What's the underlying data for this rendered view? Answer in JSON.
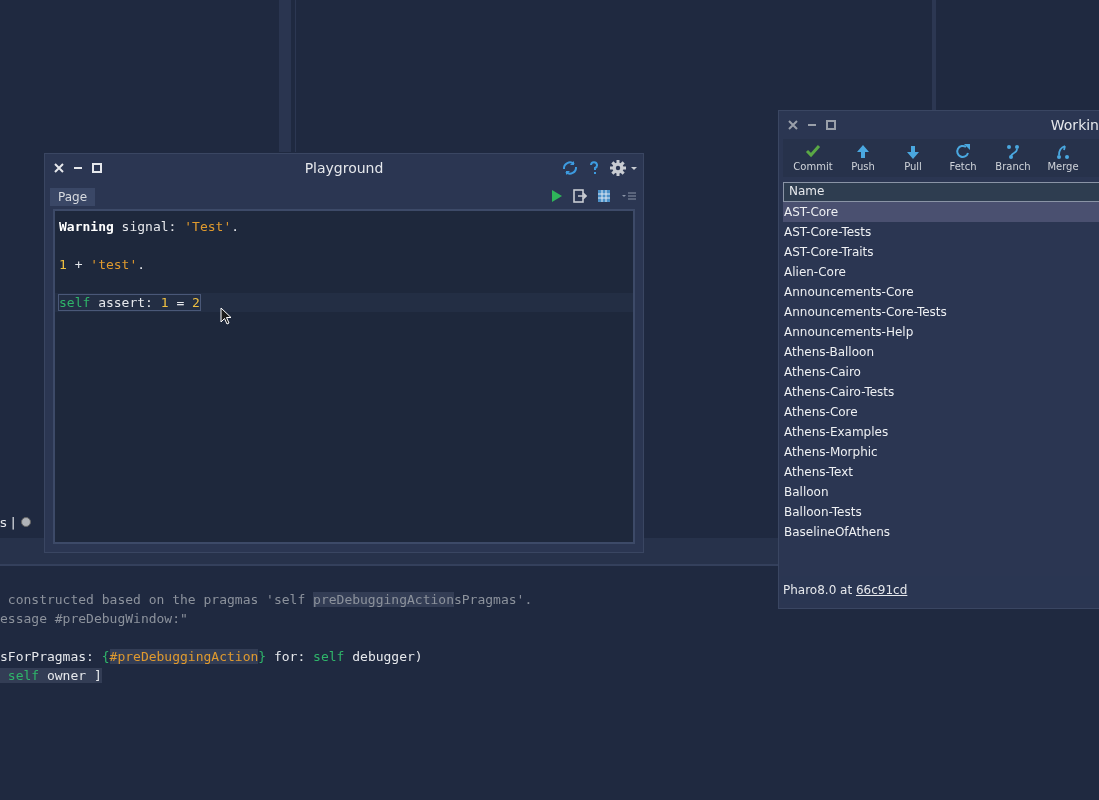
{
  "background_editor": {
    "toolbar_text": "s |",
    "code_lines": [
      {
        "kind": "code",
        "tokens": [
          {
            "text": " constructed based on the pragmas 'self ",
            "kind": "comment"
          },
          {
            "text": "preDebuggingAction",
            "kind": "comment",
            "highlighted": true
          },
          {
            "text": "sPragmas'.",
            "kind": "comment"
          }
        ]
      },
      {
        "kind": "code",
        "tokens": [
          {
            "text": "essage #preDebugWindow:\"",
            "kind": "comment"
          }
        ]
      },
      {
        "kind": "blank"
      },
      {
        "kind": "code",
        "tokens": [
          {
            "text": "sForPragmas: ",
            "kind": "plain"
          },
          {
            "text": "{",
            "kind": "keyword"
          },
          {
            "text": "#preDebuggingAction",
            "kind": "symbol",
            "highlighted": true
          },
          {
            "text": "}",
            "kind": "keyword"
          },
          {
            "text": " for: ",
            "kind": "plain"
          },
          {
            "text": "self",
            "kind": "keyword"
          },
          {
            "text": " debugger)",
            "kind": "plain"
          }
        ]
      },
      {
        "kind": "code",
        "tokens": [
          {
            "text": " self",
            "kind": "keyword",
            "highlighted": true
          },
          {
            "text": " owner ]",
            "kind": "plain",
            "highlighted": true
          }
        ]
      }
    ]
  },
  "playground": {
    "title": "Playground",
    "tabs": [
      {
        "label": "Page",
        "selected": true
      }
    ],
    "lines": [
      {
        "kind": "code",
        "current": false,
        "selected": false,
        "tokens": [
          {
            "text": "Warning",
            "kind": "bold"
          },
          {
            "text": " signal: ",
            "kind": "plain"
          },
          {
            "text": "'Test'",
            "kind": "string"
          },
          {
            "text": ".",
            "kind": "plain"
          }
        ]
      },
      {
        "kind": "blank",
        "current": false,
        "selected": false
      },
      {
        "kind": "code",
        "current": false,
        "selected": false,
        "tokens": [
          {
            "text": "1",
            "kind": "number"
          },
          {
            "text": " + ",
            "kind": "plain"
          },
          {
            "text": "'test'",
            "kind": "string"
          },
          {
            "text": ".",
            "kind": "plain"
          }
        ]
      },
      {
        "kind": "blank",
        "current": false,
        "selected": false
      },
      {
        "kind": "code",
        "current": true,
        "selected": true,
        "tokens": [
          {
            "text": "self",
            "kind": "keyword"
          },
          {
            "text": " assert: ",
            "kind": "plain"
          },
          {
            "text": "1",
            "kind": "number"
          },
          {
            "text": " = ",
            "kind": "plain"
          },
          {
            "text": "2",
            "kind": "number"
          }
        ]
      }
    ]
  },
  "working_window": {
    "title": "Workin",
    "toolbar": [
      {
        "label": "Commit",
        "kind": "check"
      },
      {
        "label": "Push",
        "kind": "up"
      },
      {
        "label": "Pull",
        "kind": "down"
      },
      {
        "label": "Fetch",
        "kind": "refresh"
      },
      {
        "label": "Branch",
        "kind": "branch"
      },
      {
        "label": "Merge",
        "kind": "merge"
      }
    ],
    "column": "Name",
    "rows": [
      {
        "name": "AST-Core",
        "selected": true
      },
      {
        "name": "AST-Core-Tests",
        "selected": false
      },
      {
        "name": "AST-Core-Traits",
        "selected": false
      },
      {
        "name": "Alien-Core",
        "selected": false
      },
      {
        "name": "Announcements-Core",
        "selected": false
      },
      {
        "name": "Announcements-Core-Tests",
        "selected": false
      },
      {
        "name": "Announcements-Help",
        "selected": false
      },
      {
        "name": "Athens-Balloon",
        "selected": false
      },
      {
        "name": "Athens-Cairo",
        "selected": false
      },
      {
        "name": "Athens-Cairo-Tests",
        "selected": false
      },
      {
        "name": "Athens-Core",
        "selected": false
      },
      {
        "name": "Athens-Examples",
        "selected": false
      },
      {
        "name": "Athens-Morphic",
        "selected": false
      },
      {
        "name": "Athens-Text",
        "selected": false
      },
      {
        "name": "Balloon",
        "selected": false
      },
      {
        "name": "Balloon-Tests",
        "selected": false
      },
      {
        "name": "BaselineOfAthens",
        "selected": false
      }
    ],
    "status": {
      "text": "Pharo8.0 at ",
      "link": "66c91cd"
    }
  }
}
